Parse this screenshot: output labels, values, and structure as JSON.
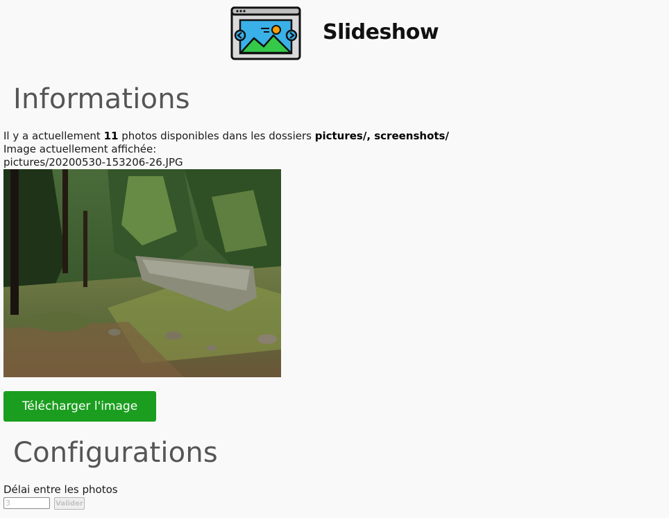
{
  "header": {
    "title": "Slideshow",
    "logo_icon": "slideshow-icon"
  },
  "informations": {
    "heading": "Informations",
    "line1_prefix": "Il y a actuellement ",
    "photo_count": "11",
    "line1_middle": " photos disponibles dans les dossiers ",
    "folders": "pictures/, screenshots/",
    "current_label": "Image actuellement affichée:",
    "current_path": "pictures/20200530-153206-26.JPG",
    "download_label": "Télécharger l'image"
  },
  "configurations": {
    "heading": "Configurations",
    "delay_label": "Délai entre les photos",
    "delay_placeholder": "3",
    "submit_label": "Valider"
  },
  "colors": {
    "accent_green": "#1b9e1f",
    "heading_gray": "#555555",
    "logo_sky": "#3ab0e8",
    "logo_grass": "#35c94a",
    "logo_sun": "#f59e0b"
  }
}
